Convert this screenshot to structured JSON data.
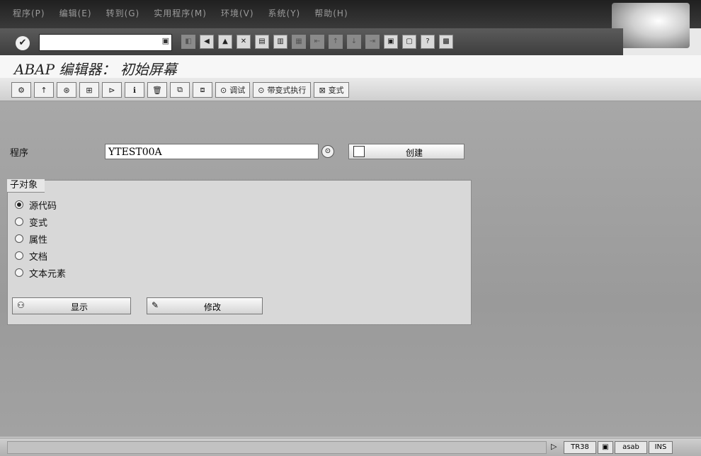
{
  "menubar": {
    "items": [
      "程序(P)",
      "编辑(E)",
      "转到(G)",
      "实用程序(M)",
      "环境(V)",
      "系统(Y)",
      "帮助(H)"
    ]
  },
  "std_toolbar": {
    "ok_icon": "check-icon",
    "command_value": "",
    "icons": [
      "save-icon",
      "back-icon",
      "exit-icon",
      "cancel-icon",
      "print-icon",
      "find-icon",
      "find-next-icon",
      "first-page-icon",
      "prev-page-icon",
      "next-page-icon",
      "last-page-icon",
      "new-session-icon",
      "shortcut-icon",
      "help-icon",
      "layout-icon"
    ]
  },
  "title": "ABAP 编辑器： 初始屏幕",
  "app_toolbar": {
    "icon_buttons": [
      "where-used-icon",
      "up-icon",
      "check-syntax-icon",
      "hierarchy-icon",
      "activate-icon",
      "info-icon",
      "delete-icon",
      "copy-icon",
      "rename-icon"
    ],
    "debug_label": "调试",
    "exec_variant_label": "带变式执行",
    "variant_label": "变式"
  },
  "form": {
    "program_label": "程序",
    "program_value": "YTEST00A",
    "create_label": "创建"
  },
  "subobjects": {
    "title": "子对象",
    "options": [
      {
        "label": "源代码",
        "selected": true
      },
      {
        "label": "变式",
        "selected": false
      },
      {
        "label": "属性",
        "selected": false
      },
      {
        "label": "文档",
        "selected": false
      },
      {
        "label": "文本元素",
        "selected": false
      }
    ],
    "display_label": "显示",
    "change_label": "修改"
  },
  "statusbar": {
    "message": "",
    "sid": "TR38",
    "client": "asab",
    "mode": "INS"
  }
}
